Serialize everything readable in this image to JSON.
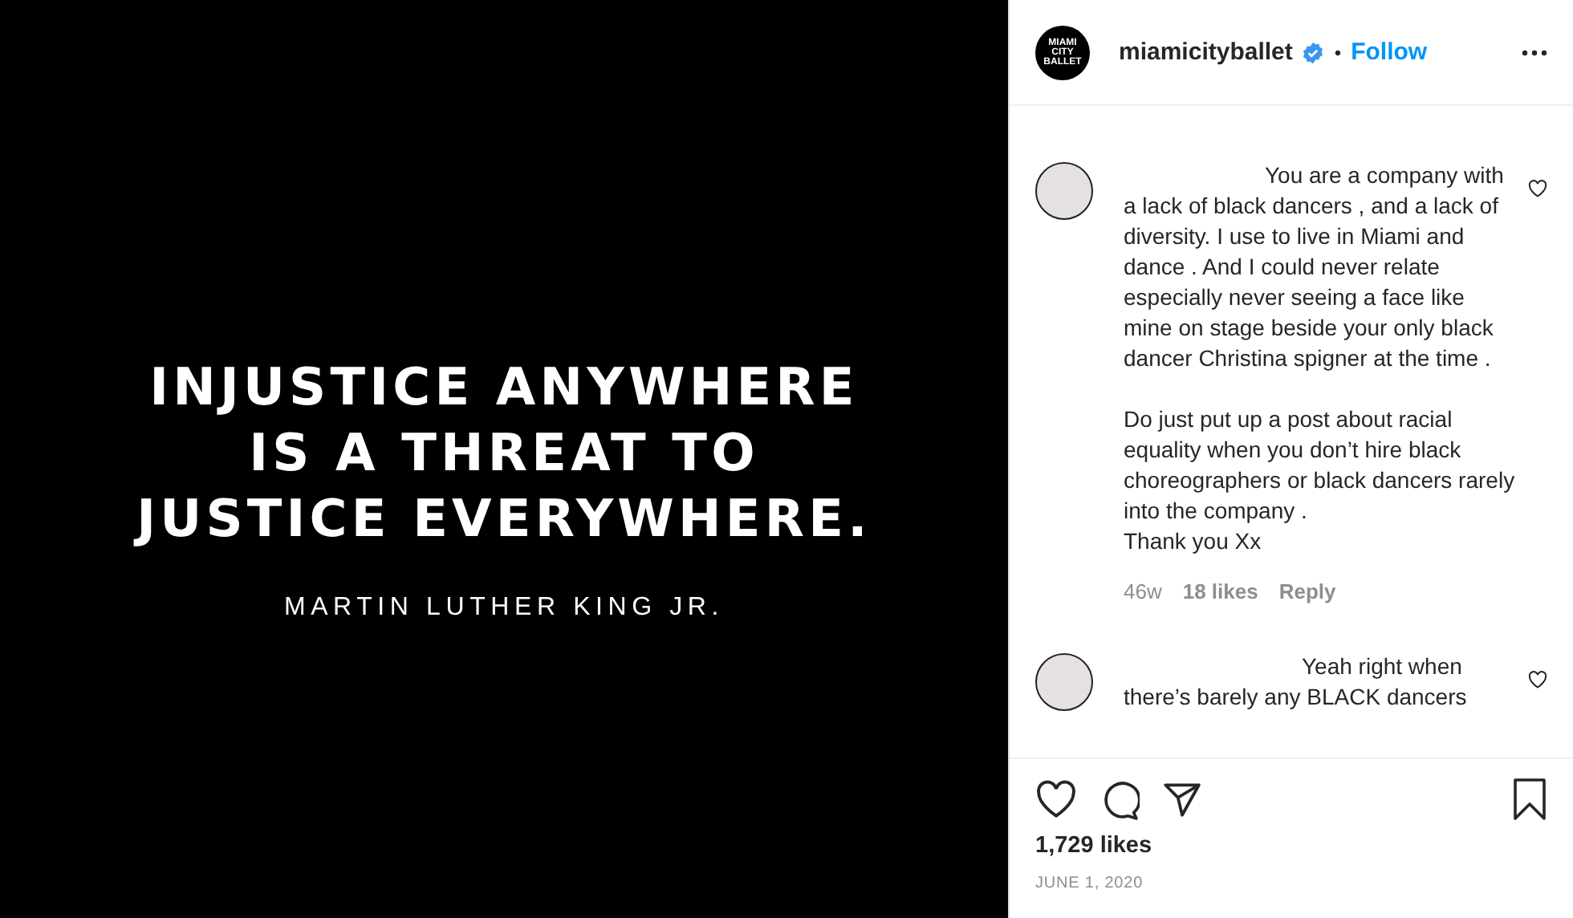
{
  "post": {
    "quote": "INJUSTICE ANYWHERE\nIS A THREAT TO\nJUSTICE EVERYWHERE.",
    "attribution": "MARTIN LUTHER KING JR."
  },
  "header": {
    "logo_text": "MIAMI\nCITY\nBALLET",
    "username": "miamicityballet",
    "verified": true,
    "separator": "•",
    "follow": "Follow"
  },
  "comments": [
    {
      "text": "You are a company with a lack of black dancers , and a lack of diversity. I use to live in Miami and dance . And I could never relate especially never seeing a face like mine on stage beside your only black dancer Christina spigner at the time .\n\nDo just put up a post about racial equality when you don’t hire black choreographers or black dancers rarely into the company .\nThank you Xx",
      "liked": false,
      "time": "46w",
      "likes": "18 likes",
      "reply": "Reply"
    },
    {
      "text": "Yeah right when there’s barely any BLACK dancers",
      "liked": false
    }
  ],
  "footer": {
    "liked": false,
    "saved": false,
    "likes": "1,729 likes",
    "date": "JUNE 1, 2020"
  }
}
